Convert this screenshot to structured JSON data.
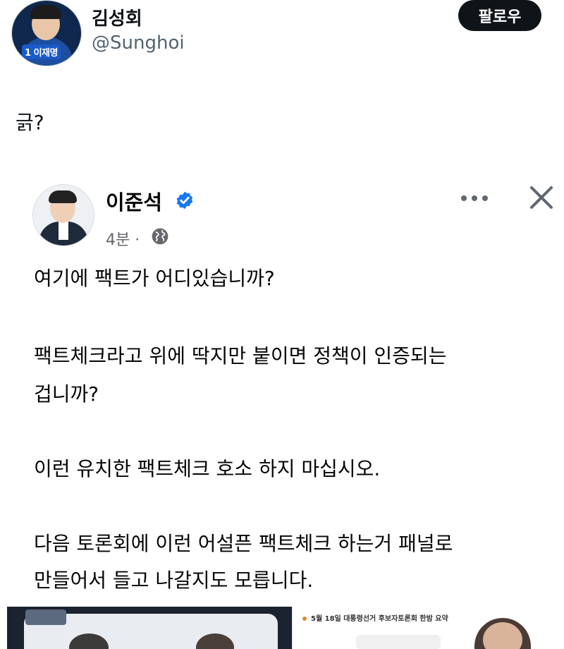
{
  "tweet": {
    "author": {
      "name": "김성회",
      "handle": "@Sunghoi",
      "avatar_badge": "1 이재명"
    },
    "follow_label": "팔로우",
    "text": "긁?"
  },
  "embedded_post": {
    "author": "이준석",
    "time": "4분",
    "separator": "·",
    "paragraphs": [
      "여기에 팩트가 어디있습니까?",
      "팩트체크라고 위에 딱지만 붙이면 정책이 인증되는",
      "겁니까?",
      "이런 유치한 팩트체크 호소 하지 마십시오.",
      "다음 토론회에 이런 어설픈 팩트체크 하는거 패널로",
      "만들어서 들고 나갈지도 모릅니다."
    ],
    "thumbnail_caption": "5월 18일 대통령선거 후보자토론회 한밤 요약"
  },
  "colors": {
    "follow_bg": "#0f1419",
    "verified": "#1877f2",
    "secondary_text": "#65676b"
  },
  "icons": [
    "verified-badge-icon",
    "globe-icon",
    "more-icon",
    "close-icon"
  ]
}
